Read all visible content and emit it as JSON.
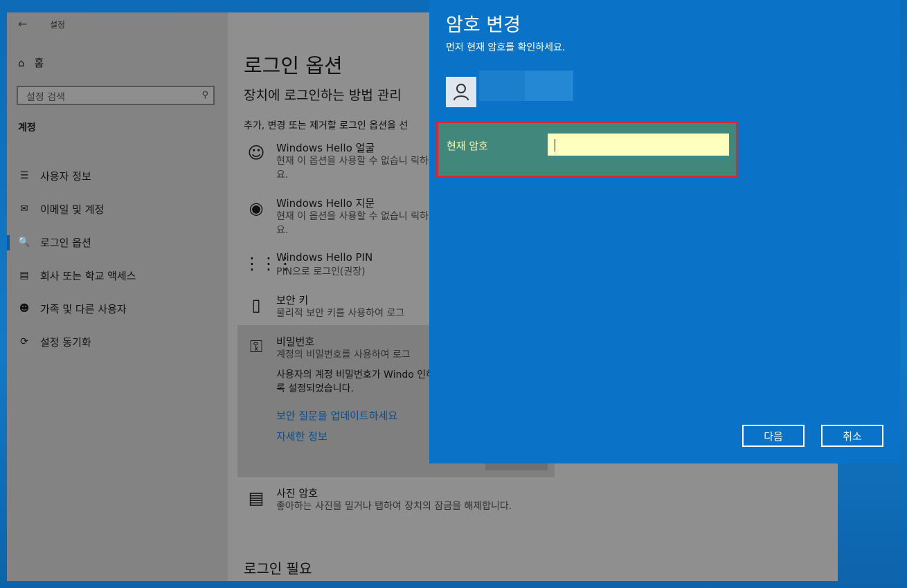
{
  "settings": {
    "window_title": "설정",
    "back_icon": "back-arrow-icon",
    "home_label": "홈",
    "search_placeholder": "설정 검색",
    "section_label": "계정",
    "nav_items": [
      {
        "icon": "user-info-icon",
        "label": "사용자 정보"
      },
      {
        "icon": "mail-icon",
        "label": "이메일 및 계정"
      },
      {
        "icon": "key-icon",
        "label": "로그인 옵션",
        "active": true
      },
      {
        "icon": "briefcase-icon",
        "label": "회사 또는 학교 액세스"
      },
      {
        "icon": "family-icon",
        "label": "가족 및 다른 사용자"
      },
      {
        "icon": "sync-icon",
        "label": "설정 동기화"
      }
    ]
  },
  "main": {
    "title": "로그인 옵션",
    "subtitle": "장치에 로그인하는 방법 관리",
    "intro": "추가, 변경 또는 제거할 로그인 옵션을 선",
    "options": [
      {
        "icon": "smile-icon",
        "title": "Windows Hello 얼굴",
        "desc": "현재 이 옵션을 사용할 수 없습니 릭하세요."
      },
      {
        "icon": "fingerprint-icon",
        "title": "Windows Hello 지문",
        "desc": "현재 이 옵션을 사용할 수 없습니 릭하세요."
      },
      {
        "icon": "keypad-icon",
        "title": "Windows Hello PIN",
        "desc": "PIN으로 로그인(권장)"
      },
      {
        "icon": "usb-key-icon",
        "title": "보안 키",
        "desc": "물리적 보안 키를 사용하여 로그"
      },
      {
        "icon": "password-key-icon",
        "title": "비밀번호",
        "desc": "계정의 비밀번호를 사용하여 로그"
      },
      {
        "icon": "picture-icon",
        "title": "사진 암호",
        "desc": "좋아하는 사진을 밀거나 탭하여 장치의 잠금을 해제합니다."
      }
    ],
    "password_info": "사용자의 계정 비밀번호가 Windo 인하도록 설정되었습니다.",
    "link_security": "보안 질문을 업데이트하세요",
    "link_more": "자세한 정보",
    "login_required": "로그인 필요"
  },
  "dialog": {
    "title": "암호 변경",
    "subtitle": "먼저 현재 암호를 확인하세요.",
    "current_password_label": "현재 암호",
    "current_password_value": "",
    "next_button": "다음",
    "cancel_button": "취소"
  }
}
